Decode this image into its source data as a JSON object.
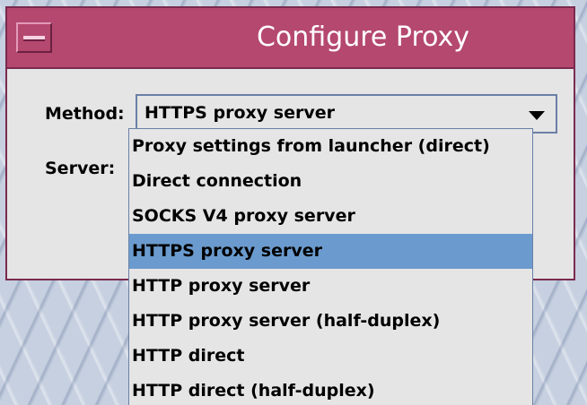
{
  "window": {
    "title": "Configure Proxy"
  },
  "form": {
    "method_label": "Method:",
    "server_label": "Server:",
    "method_value": "HTTPS proxy server"
  },
  "dropdown": {
    "options": [
      {
        "label": "Proxy settings from launcher (direct)",
        "selected": false
      },
      {
        "label": "Direct connection",
        "selected": false
      },
      {
        "label": "SOCKS V4 proxy server",
        "selected": false
      },
      {
        "label": "HTTPS proxy server",
        "selected": true
      },
      {
        "label": "HTTP proxy server",
        "selected": false
      },
      {
        "label": "HTTP proxy server (half-duplex)",
        "selected": false
      },
      {
        "label": "HTTP direct",
        "selected": false
      },
      {
        "label": "HTTP direct (half-duplex)",
        "selected": false
      }
    ]
  },
  "icons": {
    "window_menu": "window-menu-icon",
    "dropdown_arrow": "chevron-down-icon"
  },
  "colors": {
    "titlebar": "#b5486f",
    "window_border": "#7a2a4e",
    "selection": "#6b9bce",
    "background": "#e5e5e5"
  }
}
